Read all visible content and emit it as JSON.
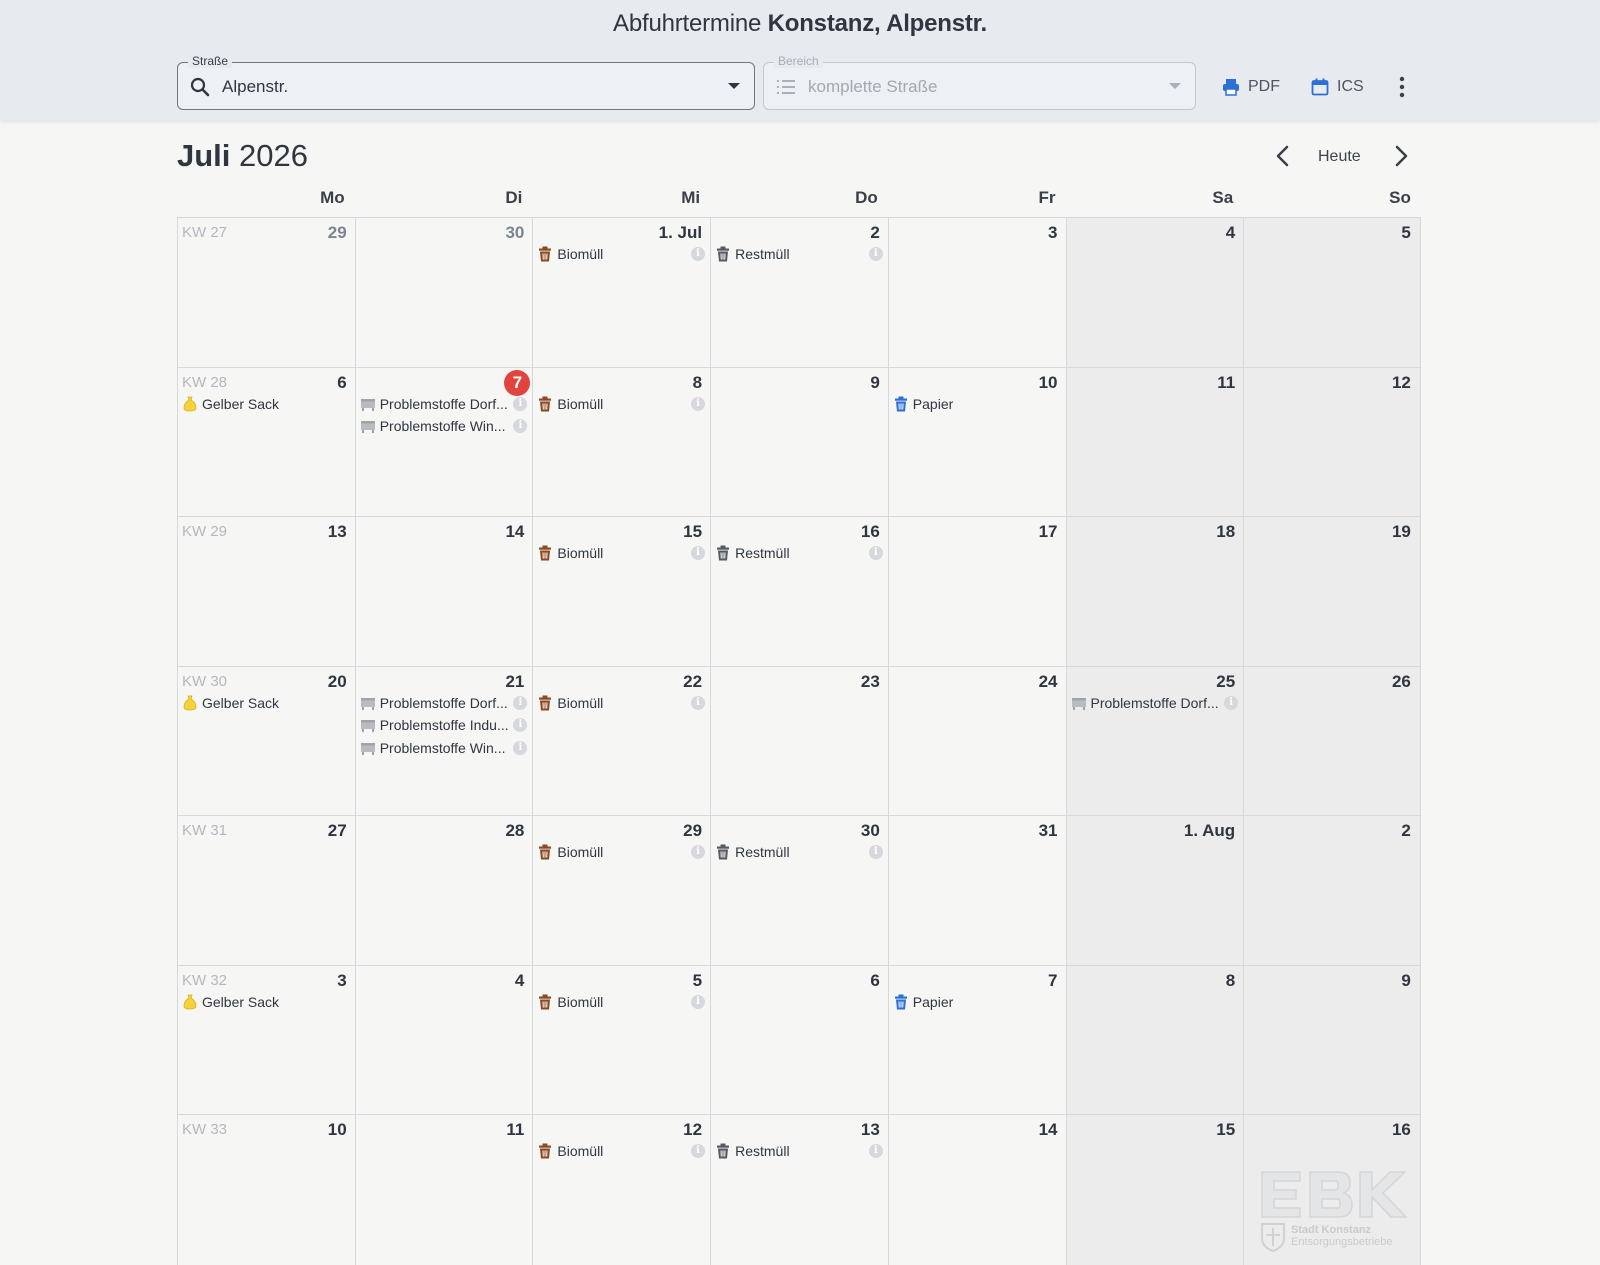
{
  "header": {
    "title_prefix": "Abfuhrtermine",
    "title_location": "Konstanz, Alpenstr.",
    "street_field": {
      "label": "Straße",
      "value": "Alpenstr.",
      "icon": "search-icon"
    },
    "area_field": {
      "label": "Bereich",
      "value": "komplette Straße",
      "icon": "list-icon",
      "disabled": true
    },
    "pdf_label": "PDF",
    "ics_label": "ICS",
    "more_icon": "more-vertical-icon"
  },
  "calendar": {
    "month": "Juli",
    "year": "2026",
    "today_label": "Heute",
    "weekdays": [
      "Mo",
      "Di",
      "Mi",
      "Do",
      "Fr",
      "Sa",
      "So"
    ],
    "colors": {
      "biomuell": "#8b4a1f",
      "restmuell": "#555a60",
      "papier": "#2c6fd6",
      "gelber_sack": "#f5d23c",
      "problemstoffe": "#b8bcc1",
      "today": "#e0443c"
    },
    "weeks": [
      {
        "kw": "KW 27",
        "days": [
          {
            "num": "29",
            "other": true,
            "events": []
          },
          {
            "num": "30",
            "other": true,
            "events": []
          },
          {
            "num": "1. Jul",
            "events": [
              {
                "type": "biomuell",
                "label": "Biomüll",
                "info": true
              }
            ]
          },
          {
            "num": "2",
            "events": [
              {
                "type": "restmuell",
                "label": "Restmüll",
                "info": true
              }
            ]
          },
          {
            "num": "3",
            "events": []
          },
          {
            "num": "4",
            "events": []
          },
          {
            "num": "5",
            "events": []
          }
        ]
      },
      {
        "kw": "KW 28",
        "days": [
          {
            "num": "6",
            "events": [
              {
                "type": "gelber_sack",
                "label": "Gelber Sack",
                "info": false
              }
            ]
          },
          {
            "num": "7",
            "today": true,
            "events": [
              {
                "type": "problemstoffe",
                "label": "Problemstoffe Dorf...",
                "info": true
              },
              {
                "type": "problemstoffe",
                "label": "Problemstoffe Win...",
                "info": true
              }
            ]
          },
          {
            "num": "8",
            "events": [
              {
                "type": "biomuell",
                "label": "Biomüll",
                "info": true
              }
            ]
          },
          {
            "num": "9",
            "events": []
          },
          {
            "num": "10",
            "events": [
              {
                "type": "papier",
                "label": "Papier",
                "info": false
              }
            ]
          },
          {
            "num": "11",
            "events": []
          },
          {
            "num": "12",
            "events": []
          }
        ]
      },
      {
        "kw": "KW 29",
        "days": [
          {
            "num": "13",
            "events": []
          },
          {
            "num": "14",
            "events": []
          },
          {
            "num": "15",
            "events": [
              {
                "type": "biomuell",
                "label": "Biomüll",
                "info": true
              }
            ]
          },
          {
            "num": "16",
            "events": [
              {
                "type": "restmuell",
                "label": "Restmüll",
                "info": true
              }
            ]
          },
          {
            "num": "17",
            "events": []
          },
          {
            "num": "18",
            "events": []
          },
          {
            "num": "19",
            "events": []
          }
        ]
      },
      {
        "kw": "KW 30",
        "days": [
          {
            "num": "20",
            "events": [
              {
                "type": "gelber_sack",
                "label": "Gelber Sack",
                "info": false
              }
            ]
          },
          {
            "num": "21",
            "events": [
              {
                "type": "problemstoffe",
                "label": "Problemstoffe Dorf...",
                "info": true
              },
              {
                "type": "problemstoffe",
                "label": "Problemstoffe Indu...",
                "info": true
              },
              {
                "type": "problemstoffe",
                "label": "Problemstoffe Win...",
                "info": true
              }
            ]
          },
          {
            "num": "22",
            "events": [
              {
                "type": "biomuell",
                "label": "Biomüll",
                "info": true
              }
            ]
          },
          {
            "num": "23",
            "events": []
          },
          {
            "num": "24",
            "events": []
          },
          {
            "num": "25",
            "events": [
              {
                "type": "problemstoffe",
                "label": "Problemstoffe Dorf...",
                "info": true
              }
            ]
          },
          {
            "num": "26",
            "events": []
          }
        ]
      },
      {
        "kw": "KW 31",
        "days": [
          {
            "num": "27",
            "events": []
          },
          {
            "num": "28",
            "events": []
          },
          {
            "num": "29",
            "events": [
              {
                "type": "biomuell",
                "label": "Biomüll",
                "info": true
              }
            ]
          },
          {
            "num": "30",
            "events": [
              {
                "type": "restmuell",
                "label": "Restmüll",
                "info": true
              }
            ]
          },
          {
            "num": "31",
            "events": []
          },
          {
            "num": "1. Aug",
            "events": []
          },
          {
            "num": "2",
            "events": []
          }
        ]
      },
      {
        "kw": "KW 32",
        "days": [
          {
            "num": "3",
            "events": [
              {
                "type": "gelber_sack",
                "label": "Gelber Sack",
                "info": false
              }
            ]
          },
          {
            "num": "4",
            "events": []
          },
          {
            "num": "5",
            "events": [
              {
                "type": "biomuell",
                "label": "Biomüll",
                "info": true
              }
            ]
          },
          {
            "num": "6",
            "events": []
          },
          {
            "num": "7",
            "events": [
              {
                "type": "papier",
                "label": "Papier",
                "info": false
              }
            ]
          },
          {
            "num": "8",
            "events": []
          },
          {
            "num": "9",
            "events": []
          }
        ]
      },
      {
        "kw": "KW 33",
        "days": [
          {
            "num": "10",
            "events": []
          },
          {
            "num": "11",
            "events": []
          },
          {
            "num": "12",
            "events": [
              {
                "type": "biomuell",
                "label": "Biomüll",
                "info": true
              }
            ]
          },
          {
            "num": "13",
            "events": [
              {
                "type": "restmuell",
                "label": "Restmüll",
                "info": true
              }
            ]
          },
          {
            "num": "14",
            "events": []
          },
          {
            "num": "15",
            "events": []
          },
          {
            "num": "16",
            "events": []
          }
        ]
      }
    ]
  },
  "logo": {
    "letters": "EBK",
    "line1": "Stadt Konstanz",
    "line2": "Entsorgungsbetriebe"
  }
}
